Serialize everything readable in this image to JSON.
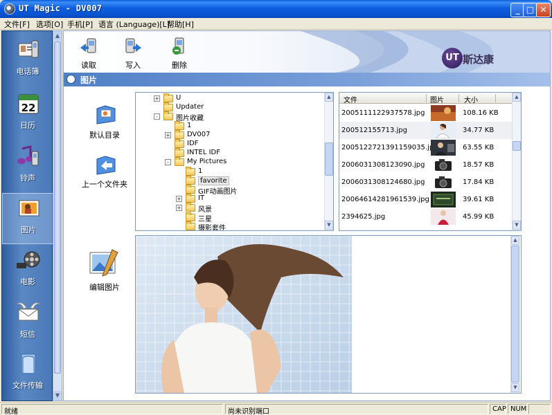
{
  "window": {
    "title": "UT Magic - DV007",
    "min": "_",
    "max": "□",
    "close": "✕"
  },
  "menu": [
    "文件[F]",
    "选项[O]",
    "手机[P]",
    "语言 (Language)[L]",
    "帮助[H]"
  ],
  "sidebar": {
    "items": [
      {
        "label": "电话簿",
        "icon": "phonebook-icon"
      },
      {
        "label": "日历",
        "icon": "calendar-icon",
        "date": "22"
      },
      {
        "label": "铃声",
        "icon": "ringtone-icon"
      },
      {
        "label": "图片",
        "icon": "picture-icon",
        "active": true
      },
      {
        "label": "电影",
        "icon": "movie-icon"
      },
      {
        "label": "短信",
        "icon": "sms-icon"
      },
      {
        "label": "文件传输",
        "icon": "file-transfer-icon"
      }
    ]
  },
  "toolbar": {
    "read_label": "读取",
    "write_label": "写入",
    "delete_label": "删除",
    "logo_mark": "UT",
    "logo_text": "斯达康"
  },
  "section": {
    "title": "图片"
  },
  "actions": {
    "default_dir_label": "默认目录",
    "parent_folder_label": "上一个文件夹",
    "edit_picture_label": "编辑图片"
  },
  "tree": {
    "rows": [
      {
        "label": "U",
        "expander": "+",
        "indent": 1
      },
      {
        "label": "Updater",
        "expander": "",
        "indent": 1
      },
      {
        "label": "图片收藏",
        "expander": "-",
        "indent": 1
      },
      {
        "label": "1",
        "expander": "",
        "indent": 2
      },
      {
        "label": "DV007",
        "expander": "+",
        "indent": 2
      },
      {
        "label": "IDF",
        "expander": "",
        "indent": 2
      },
      {
        "label": "INTEL IDF",
        "expander": "",
        "indent": 2
      },
      {
        "label": "My Pictures",
        "expander": "-",
        "indent": 2
      },
      {
        "label": "1",
        "expander": "",
        "indent": 3
      },
      {
        "label": "favorite",
        "expander": "",
        "indent": 3,
        "selected": true
      },
      {
        "label": "GIF动画图片",
        "expander": "",
        "indent": 3
      },
      {
        "label": "IT",
        "expander": "+",
        "indent": 3
      },
      {
        "label": "风景",
        "expander": "+",
        "indent": 3
      },
      {
        "label": "三星",
        "expander": "",
        "indent": 3
      },
      {
        "label": "摄影套件",
        "expander": "",
        "indent": 3
      }
    ]
  },
  "filelist": {
    "columns": [
      "文件",
      "图片",
      "大小"
    ],
    "rows": [
      {
        "name": "2005111122937578.jpg",
        "size": "108.16 KB",
        "thumb": "autumn"
      },
      {
        "name": "200512155713.jpg",
        "size": "34.77 KB",
        "thumb": "woman-white",
        "selected": true
      },
      {
        "name": "2005122721391159035.jpg",
        "size": "63.55 KB",
        "thumb": "woman-dark"
      },
      {
        "name": "2006031308123090.jpg",
        "size": "18.57 KB",
        "thumb": "camera"
      },
      {
        "name": "2006031308124680.jpg",
        "size": "17.84 KB",
        "thumb": "camera"
      },
      {
        "name": "20064614281961539.jpg",
        "size": "39.61 KB",
        "thumb": "green-card"
      },
      {
        "name": "2394625.jpg",
        "size": "45.99 KB",
        "thumb": "woman-red"
      }
    ]
  },
  "status": {
    "left": "就绪",
    "center": "尚未识别端口",
    "cap": "CAP",
    "num": "NUM"
  },
  "colors": {
    "titlebar": "#0a52cf",
    "sidebar": "#4b79b8",
    "section_bar": "#4f7fc6",
    "selection": "#eef0f4"
  }
}
